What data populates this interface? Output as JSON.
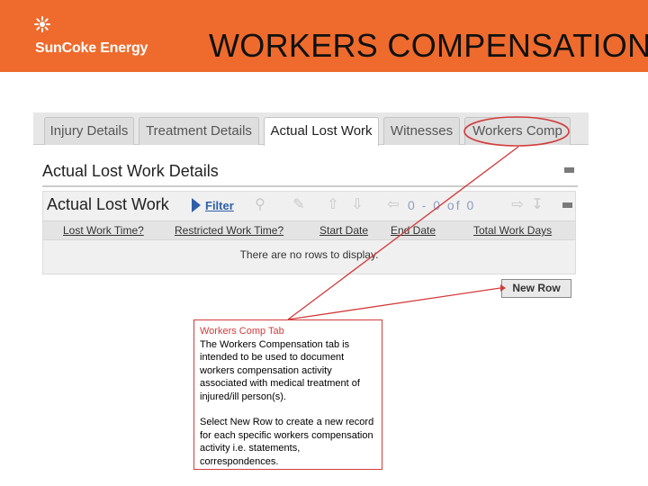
{
  "header": {
    "logo_text": "SunCoke Energy",
    "title": "WORKERS COMPENSATION",
    "background_color": "#ee6b2d"
  },
  "tabs": [
    {
      "label": "Injury Details"
    },
    {
      "label": "Treatment Details"
    },
    {
      "label": "Actual Lost Work",
      "active": true
    },
    {
      "label": "Witnesses"
    },
    {
      "label": "Workers Comp"
    }
  ],
  "section": {
    "title": "Actual Lost Work Details"
  },
  "subpanel": {
    "title": "Actual Lost Work",
    "filter_label": "Filter",
    "pager_text": "0 - 0 of 0",
    "columns": [
      "Lost Work Time?",
      "Restricted Work Time?",
      "Start Date",
      "End Date",
      "Total Work Days"
    ],
    "empty_message": "There are no rows to display."
  },
  "new_row_label": "New Row",
  "callout": {
    "title": "Workers Comp Tab",
    "body": "The Workers Compensation tab is intended to be used to document workers compensation activity associated with medical treatment of injured/ill person(s).",
    "body2": "Select New Row to create a new record for each specific workers compensation activity i.e. statements, correspondences.",
    "color": "#d23b3b"
  }
}
